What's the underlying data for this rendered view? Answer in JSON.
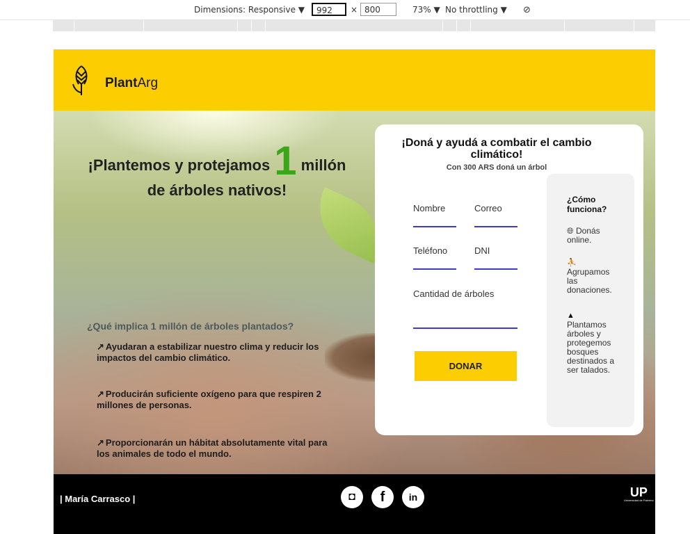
{
  "devtools": {
    "dimensions_label": "Dimensions: Responsive ▼",
    "width": "992",
    "width_spin": "≑",
    "times": "×",
    "height": "800",
    "zoom": "73% ▼",
    "throttling": "No throttling ▼",
    "rotate_icon": "⃠"
  },
  "header": {
    "brand_bold": "Plant",
    "brand_rest": "Arg"
  },
  "hero": {
    "title_pre": "¡Plantemos y protejamos ",
    "title_number": "1",
    "title_post": " millón",
    "title_line2": "de árboles nativos!",
    "question": "¿Qué implica 1 millón de árboles plantados?",
    "arrow": "↗",
    "points": [
      "Ayudaran a estabilizar nuestro clima y reducir los impactos del cambio climático.",
      "Producirán suficiente oxígeno para que respiren 2 millones de personas.",
      "Proporcionarán un hábitat absolutamente vital para los animales de todo el mundo."
    ]
  },
  "form": {
    "title": "¡Doná y ayudá a combatir el cambio climático!",
    "subtitle": "Con 300 ARS doná un árbol",
    "name_label": "Nombre",
    "email_label": "Correo",
    "phone_label": "Teléfono",
    "dni_label": "DNI",
    "trees_label": "Cantidad de árboles",
    "submit": "DONAR",
    "how": {
      "title": "¿Cómo funciona?",
      "steps": [
        {
          "icon": "globe-icon",
          "glyph": "🌐",
          "text": "Donás online."
        },
        {
          "icon": "hands-icon",
          "glyph": "⛹",
          "text": "Agrupamos las donaciones."
        },
        {
          "icon": "tree-icon",
          "glyph": "▲",
          "text": "Plantamos árboles y protegemos bosques destinados a ser talados."
        }
      ]
    }
  },
  "footer": {
    "author": "| María Carrasco |",
    "instagram": "◘",
    "facebook": "f",
    "linkedin": "in",
    "up_logo": "UP",
    "up_sub": "Universidad de Palermo"
  },
  "colors": {
    "brand_yellow": "#fccd00",
    "accent_green": "#3aa619",
    "input_line": "#3b3bd1"
  }
}
